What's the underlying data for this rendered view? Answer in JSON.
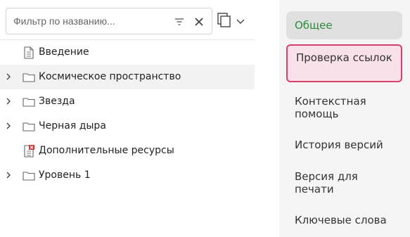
{
  "filter": {
    "placeholder": "Фильтр по названию..."
  },
  "tree": {
    "items": [
      {
        "label": "Введение",
        "icon": "document-icon",
        "expandable": false,
        "selected": false
      },
      {
        "label": "Космическое пространство",
        "icon": "folder-icon",
        "expandable": true,
        "selected": true
      },
      {
        "label": "Звезда",
        "icon": "folder-icon",
        "expandable": true,
        "selected": false
      },
      {
        "label": "Черная дыра",
        "icon": "folder-icon",
        "expandable": true,
        "selected": false
      },
      {
        "label": "Дополнительные ресурсы",
        "icon": "document-error-icon",
        "expandable": false,
        "selected": false
      },
      {
        "label": "Уровень 1",
        "icon": "folder-icon",
        "expandable": true,
        "selected": false
      }
    ]
  },
  "side": {
    "items": [
      {
        "label": "Общее",
        "state": "active"
      },
      {
        "label": "Проверка ссылок",
        "state": "highlight"
      },
      {
        "label": "Контекстная помощь",
        "state": "normal"
      },
      {
        "label": "История версий",
        "state": "normal"
      },
      {
        "label": "Версия для печати",
        "state": "normal"
      },
      {
        "label": "Ключевые слова",
        "state": "normal"
      }
    ]
  },
  "colors": {
    "active_text": "#2e8a3d",
    "highlight_border": "#d8406b",
    "highlight_bg": "#f8e1e8",
    "error_badge": "#d32f2f"
  }
}
